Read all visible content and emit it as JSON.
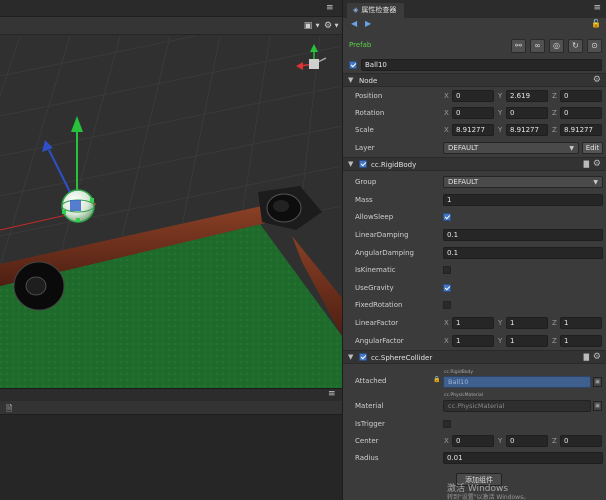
{
  "scene": {
    "toolbar_menu_icon": "≡",
    "view_icon": "▣",
    "gear_icon": "⚙"
  },
  "inspector": {
    "tab_title": "属性检查器",
    "prefab_label": "Prefab",
    "node_name": "Ball10",
    "node_section": "Node",
    "position": {
      "label": "Position",
      "x": "0",
      "y": "2.619",
      "z": "0"
    },
    "rotation": {
      "label": "Rotation",
      "x": "0",
      "y": "0",
      "z": "0"
    },
    "scale": {
      "label": "Scale",
      "x": "8.91277",
      "y": "8.91277",
      "z": "8.91277"
    },
    "layer": {
      "label": "Layer",
      "value": "DEFAULT",
      "edit": "Edit"
    },
    "rigidbody": {
      "title": "cc.RigidBody",
      "group": {
        "label": "Group",
        "value": "DEFAULT"
      },
      "mass": {
        "label": "Mass",
        "value": "1"
      },
      "allow_sleep": {
        "label": "AllowSleep",
        "checked": true
      },
      "linear_damping": {
        "label": "LinearDamping",
        "value": "0.1"
      },
      "angular_damping": {
        "label": "AngularDamping",
        "value": "0.1"
      },
      "is_kinematic": {
        "label": "IsKinematic",
        "checked": false
      },
      "use_gravity": {
        "label": "UseGravity",
        "checked": true
      },
      "fixed_rotation": {
        "label": "FixedRotation",
        "checked": false
      },
      "linear_factor": {
        "label": "LinearFactor",
        "x": "1",
        "y": "1",
        "z": "1"
      },
      "angular_factor": {
        "label": "AngularFactor",
        "x": "1",
        "y": "1",
        "z": "1"
      }
    },
    "sphere_collider": {
      "title": "cc.SphereCollider",
      "attached": {
        "label": "Attached",
        "tag": "cc.RigidBody",
        "value": "Ball10"
      },
      "material": {
        "label": "Material",
        "tag": "cc.PhysicMaterial",
        "value": "cc.PhysicMaterial"
      },
      "is_trigger": {
        "label": "IsTrigger",
        "checked": false
      },
      "center": {
        "label": "Center",
        "x": "0",
        "y": "0",
        "z": "0"
      },
      "radius": {
        "label": "Radius",
        "value": "0.01"
      }
    },
    "add_component": "添加组件",
    "axis_x": "X",
    "axis_y": "Y",
    "axis_z": "Z"
  },
  "watermark": {
    "line1": "激活 Windows",
    "line2": "转到\"设置\"以激活 Windows。"
  },
  "colors": {
    "felt": "#1f6b2c",
    "rail_wood": "#6b2f1c",
    "accent_blue": "#4577c4",
    "prefab_green": "#5fd04a"
  }
}
